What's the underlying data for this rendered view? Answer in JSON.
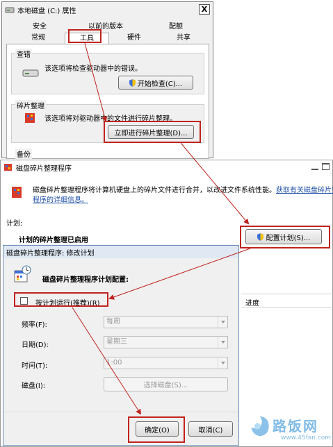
{
  "properties_window": {
    "title": "本地磁盘 (C:) 属性",
    "close_glyph": "X",
    "tabs_top": [
      "安全",
      "以前的版本",
      "配额"
    ],
    "tabs_bottom": [
      "常规",
      "工具",
      "硬件",
      "共享"
    ],
    "error_check": {
      "group_label": "查错",
      "description": "该选项将检查驱动器中的错误。",
      "button": "开始检查(C)..."
    },
    "defrag": {
      "group_label": "碎片整理",
      "description": "该选项将对驱动器中的文件进行碎片整理。",
      "button": "立即进行碎片整理(D)..."
    },
    "backup": {
      "group_label": "备份"
    }
  },
  "defrag_window": {
    "title": "磁盘碎片整理程序",
    "intro_text": "磁盘碎片整理程序将计算机硬盘上的碎片文件进行合并，以改进文件系统性能。",
    "link_text_1": "获取有关磁盘碎片整理",
    "link_text_2": "程序的详细信息。",
    "schedule_label": "计划:",
    "schedule_status": "计划的碎片整理已启用",
    "configure_button": "配置计划(S)...",
    "progress_header": "进度"
  },
  "modify_dialog": {
    "title": "磁盘碎片整理程序: 修改计划",
    "heading": "磁盘碎片整理程序计划配置:",
    "run_on_schedule_label": "按计划运行(推荐)(R)",
    "run_on_schedule_checked": false,
    "frequency": {
      "label": "频率(F):",
      "value": "每周"
    },
    "day": {
      "label": "日期(D):",
      "value": "星期三"
    },
    "time": {
      "label": "时间(T):",
      "value": "1:00"
    },
    "disk": {
      "label": "磁盘(I):",
      "button": "选择磁盘(S)..."
    },
    "ok_button": "确定(O)",
    "cancel_button": "取消(C)"
  },
  "watermark": {
    "name": "路饭网",
    "url": "www.45fan.com"
  },
  "colors": {
    "annotation_red": "#c0231e",
    "link_blue": "#1f4fa8",
    "dialog_bg": "#f0f0f0"
  }
}
